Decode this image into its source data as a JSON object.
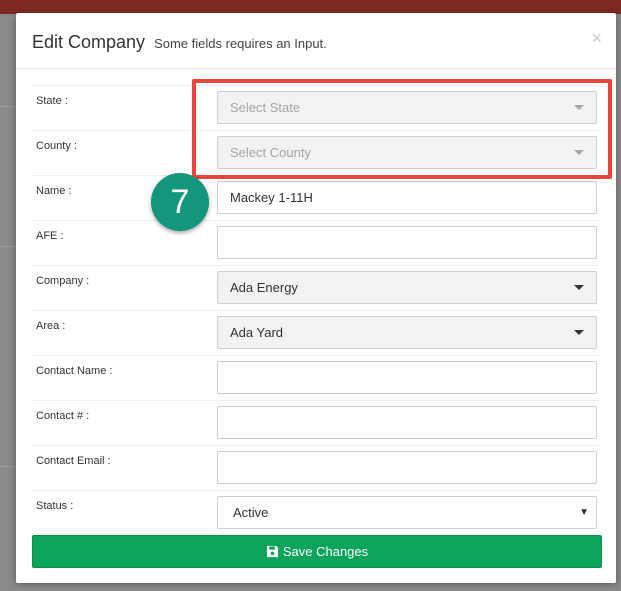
{
  "modal": {
    "title": "Edit Company",
    "subtitle": "Some fields requires an Input.",
    "close_symbol": "×"
  },
  "form": {
    "state": {
      "label": "State :",
      "placeholder": "Select State",
      "icon": "chevron-down-icon"
    },
    "county": {
      "label": "County :",
      "placeholder": "Select County",
      "icon": "chevron-down-icon"
    },
    "name": {
      "label": "Name :",
      "value": "Mackey 1-11H"
    },
    "afe": {
      "label": "AFE :",
      "value": ""
    },
    "company": {
      "label": "Company :",
      "value": "Ada Energy",
      "icon": "chevron-down-icon"
    },
    "area": {
      "label": "Area :",
      "value": "Ada Yard",
      "icon": "chevron-down-icon"
    },
    "contact_name": {
      "label": "Contact Name :",
      "value": ""
    },
    "contact_number": {
      "label": "Contact # :",
      "value": ""
    },
    "contact_email": {
      "label": "Contact Email :",
      "value": ""
    },
    "status": {
      "label": "Status :",
      "value": "Active",
      "caret_symbol": "▼"
    }
  },
  "actions": {
    "save_label": "Save Changes",
    "save_icon": "floppy-disk-icon"
  },
  "annotation": {
    "step_number": "7",
    "highlight_color": "#e8453c",
    "badge_color": "#14967d"
  },
  "colors": {
    "primary_green": "#0ca45a",
    "backdrop_header": "#7e2a22"
  }
}
